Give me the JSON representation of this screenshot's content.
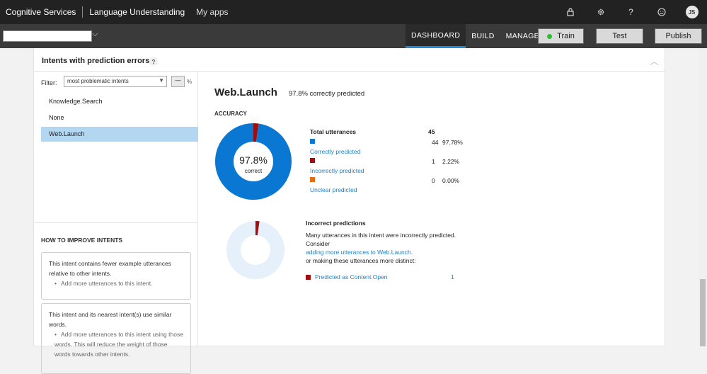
{
  "topbar": {
    "brand": "Cognitive Services",
    "product": "Language Understanding",
    "my_apps": "My apps",
    "avatar_initials": "JS",
    "icons": [
      "lock-icon",
      "gear-icon",
      "help-icon",
      "smiley-icon"
    ]
  },
  "subbar": {
    "app_select_value": "",
    "tabs": [
      {
        "label": "DASHBOARD",
        "active": true
      },
      {
        "label": "BUILD",
        "active": false
      },
      {
        "label": "MANAGE",
        "active": false
      }
    ],
    "train_label": "Train",
    "test_label": "Test",
    "publish_label": "Publish",
    "train_status_color": "#2ebd2e"
  },
  "panel": {
    "title": "Intents with prediction errors",
    "help": "?",
    "filter": {
      "label": "Filter:",
      "value": "most problematic intents",
      "threshold_button": "—",
      "percent_sign": "%"
    },
    "intents": [
      {
        "label": "Knowledge.Search",
        "selected": false
      },
      {
        "label": "None",
        "selected": false
      },
      {
        "label": "Web.Launch",
        "selected": true
      }
    ],
    "improve": {
      "title": "HOW TO IMPROVE INTENTS",
      "cards": [
        {
          "text": "This intent contains fewer example utterances relative to other intents.",
          "bullet": "Add more utterances to this intent."
        },
        {
          "text": "This intent and its nearest intent(s) use similar words.",
          "bullet": "Add more utterances to this intent using those words. This will reduce the weight of those words towards other intents."
        }
      ]
    }
  },
  "detail": {
    "intent_name": "Web.Launch",
    "summary": "97.8% correctly predicted",
    "accuracy_label": "ACCURACY",
    "donut_center_value": "97.8%",
    "donut_center_label": "correct",
    "total_label": "Total utterances",
    "total_value": "45",
    "breakdown": [
      {
        "label": "Correctly predicted",
        "count": "44",
        "percent": "97.78%",
        "color": "#0a78d2"
      },
      {
        "label": "Incorrectly predicted",
        "count": "1",
        "percent": "2.22%",
        "color": "#a10c0c"
      },
      {
        "label": "Unclear predicted",
        "count": "0",
        "percent": "0.00%",
        "color": "#e86a12"
      }
    ],
    "incorrect": {
      "title": "Incorrect predictions",
      "line1": "Many utterances in this intent were incorrectly predicted.",
      "line2": "Consider",
      "link": "adding more utterances to Web.Launch.",
      "line3": "or making these utterances more distinct:",
      "predicted_as": "Predicted as Content.Open",
      "predicted_count": "1",
      "incorrect_fraction": 0.0222
    }
  },
  "colors": {
    "correct": "#0a78d2",
    "incorrect": "#a10c0c",
    "unclear": "#e86a12",
    "light_ring": "#e5f0fb",
    "selected_row": "#b3d7f0",
    "accent": "#1f8dd6"
  }
}
